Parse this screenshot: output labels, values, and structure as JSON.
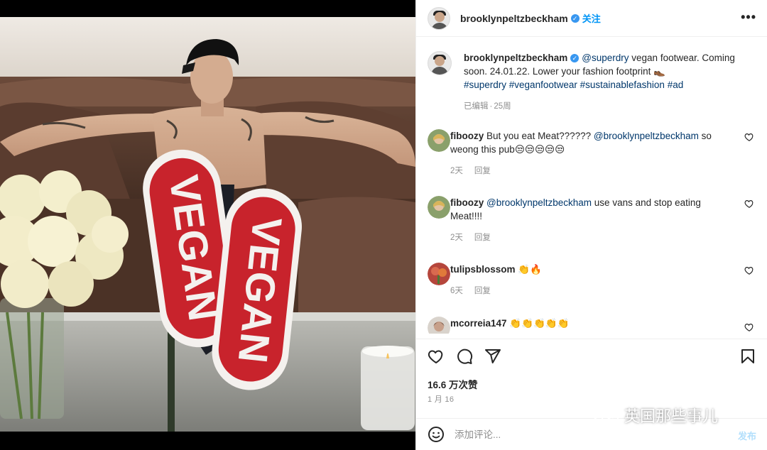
{
  "post": {
    "username": "brooklynpeltzbeckham",
    "verified_glyph": "✓",
    "follow_label": "关注",
    "more_label": "•••"
  },
  "caption": {
    "username": "brooklynpeltzbeckham",
    "mention": "@superdry",
    "text": " vegan footwear. Coming soon. 24.01.22. Lower your fashion footprint 👞",
    "hashtags": "#superdry #veganfootwear #sustainablefashion #ad",
    "edited": "已编辑",
    "sep": "·",
    "time": "25周"
  },
  "comments": [
    {
      "username": "fiboozy",
      "text_before": "But you eat Meat?????? ",
      "mention": "@brooklynpeltzbeckham",
      "text_after": " so weong this pub😒😒😒😒😒",
      "time": "2天",
      "reply_label": "回复"
    },
    {
      "username": "fiboozy",
      "text_before": "",
      "mention": "@brooklynpeltzbeckham",
      "text_after": " use vans and stop eating Meat!!!!",
      "time": "2天",
      "reply_label": "回复"
    },
    {
      "username": "tulipsblossom",
      "text_before": "👏🔥",
      "mention": "",
      "text_after": "",
      "time": "6天",
      "reply_label": "回复"
    },
    {
      "username": "mcorreia147",
      "text_before": "👏👏👏👏👏",
      "mention": "",
      "text_after": "",
      "time": "",
      "reply_label": ""
    }
  ],
  "actions": {
    "likes": "16.6 万次赞",
    "date": "1 月 16"
  },
  "composer": {
    "placeholder": "添加评论...",
    "post_label": "发布"
  },
  "watermark": {
    "text": "英国那些事儿"
  },
  "photo_text": {
    "left_sole": "VEGAN",
    "right_sole": "VEGAN"
  },
  "colors": {
    "link": "#00376b",
    "follow": "#0095f6",
    "meta": "#8e8e8e",
    "sole_red": "#c8232c"
  }
}
